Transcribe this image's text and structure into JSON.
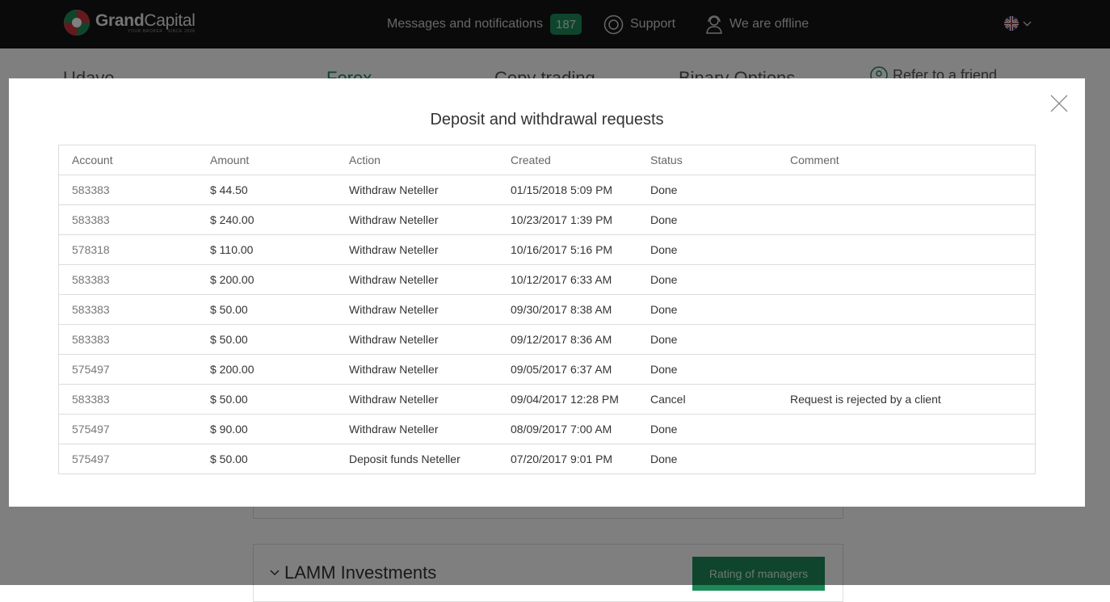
{
  "header": {
    "logo": {
      "word_bold": "Grand",
      "word_light": "Capital",
      "tagline": "YOUR BROKER · SINCE 2006"
    },
    "messages_label": "Messages and notifications",
    "messages_count": "187",
    "support_label": "Support",
    "offline_label": "We are offline",
    "language_icon": "uk-flag-icon"
  },
  "background": {
    "tabs": [
      "Udave",
      "Forex",
      "Copy trading",
      "Binary Options"
    ],
    "refer_label": "Refer to a friend",
    "lamm_title": "LAMM Investments",
    "rating_button": "Rating of managers"
  },
  "modal": {
    "title": "Deposit and withdrawal requests",
    "close_icon": "close-icon",
    "columns": [
      "Account",
      "Amount",
      "Action",
      "Created",
      "Status",
      "Comment"
    ],
    "rows": [
      [
        "583383",
        "$ 44.50",
        "Withdraw Neteller",
        "01/15/2018 5:09 PM",
        "Done",
        ""
      ],
      [
        "583383",
        "$ 240.00",
        "Withdraw Neteller",
        "10/23/2017 1:39 PM",
        "Done",
        ""
      ],
      [
        "578318",
        "$ 110.00",
        "Withdraw Neteller",
        "10/16/2017 5:16 PM",
        "Done",
        ""
      ],
      [
        "583383",
        "$ 200.00",
        "Withdraw Neteller",
        "10/12/2017 6:33 AM",
        "Done",
        ""
      ],
      [
        "583383",
        "$ 50.00",
        "Withdraw Neteller",
        "09/30/2017 8:38 AM",
        "Done",
        ""
      ],
      [
        "583383",
        "$ 50.00",
        "Withdraw Neteller",
        "09/12/2017 8:36 AM",
        "Done",
        ""
      ],
      [
        "575497",
        "$ 200.00",
        "Withdraw Neteller",
        "09/05/2017 6:37 AM",
        "Done",
        ""
      ],
      [
        "583383",
        "$ 50.00",
        "Withdraw Neteller",
        "09/04/2017 12:28 PM",
        "Cancel",
        "Request is rejected by a client"
      ],
      [
        "575497",
        "$ 90.00",
        "Withdraw Neteller",
        "08/09/2017 7:00 AM",
        "Done",
        ""
      ],
      [
        "575497",
        "$ 50.00",
        "Deposit funds Neteller",
        "07/20/2017 9:01 PM",
        "Done",
        ""
      ]
    ]
  },
  "colors": {
    "accent": "#1c8a58",
    "header_bg": "#141414",
    "overlay": "#000000"
  }
}
